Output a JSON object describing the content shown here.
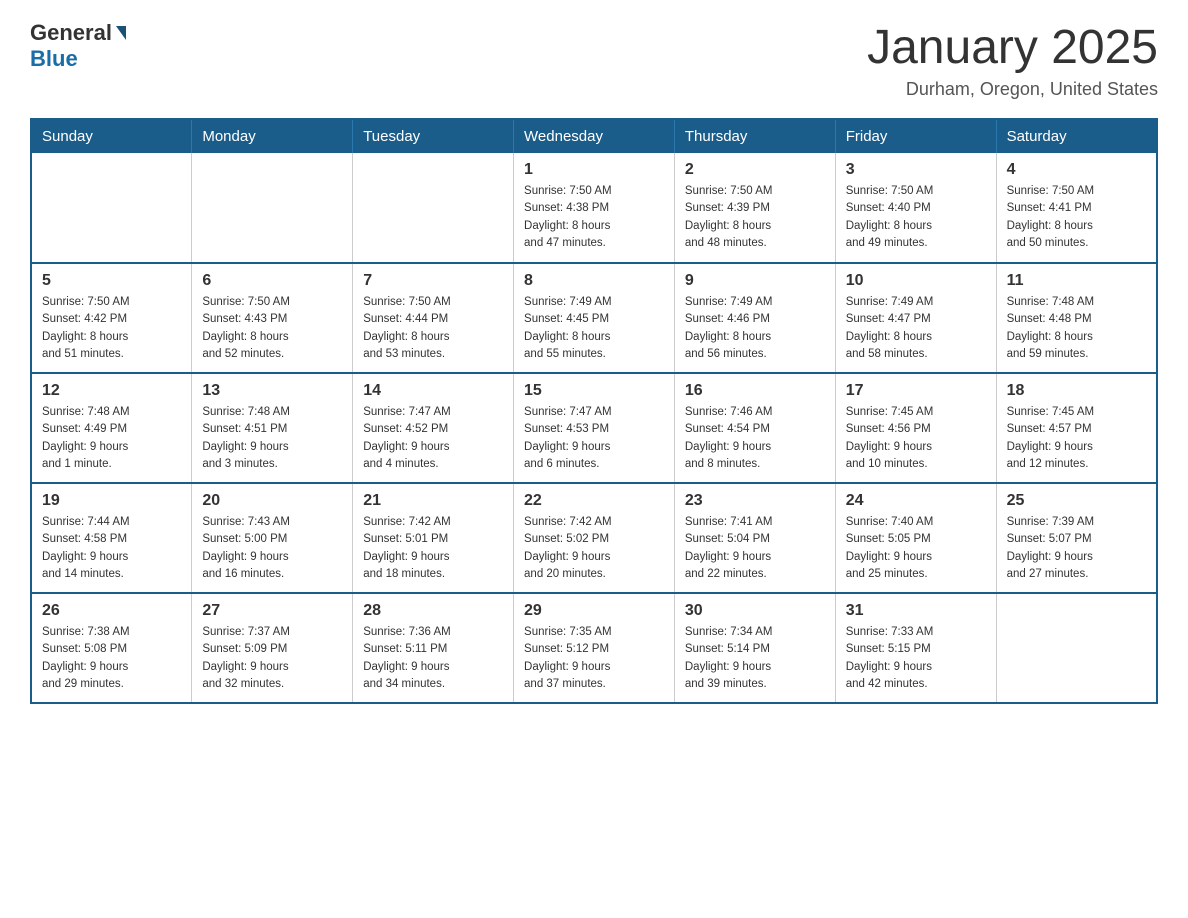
{
  "header": {
    "logo_text_general": "General",
    "logo_text_blue": "Blue",
    "month_title": "January 2025",
    "location": "Durham, Oregon, United States"
  },
  "calendar": {
    "days_of_week": [
      "Sunday",
      "Monday",
      "Tuesday",
      "Wednesday",
      "Thursday",
      "Friday",
      "Saturday"
    ],
    "weeks": [
      [
        {
          "day": "",
          "info": ""
        },
        {
          "day": "",
          "info": ""
        },
        {
          "day": "",
          "info": ""
        },
        {
          "day": "1",
          "info": "Sunrise: 7:50 AM\nSunset: 4:38 PM\nDaylight: 8 hours\nand 47 minutes."
        },
        {
          "day": "2",
          "info": "Sunrise: 7:50 AM\nSunset: 4:39 PM\nDaylight: 8 hours\nand 48 minutes."
        },
        {
          "day": "3",
          "info": "Sunrise: 7:50 AM\nSunset: 4:40 PM\nDaylight: 8 hours\nand 49 minutes."
        },
        {
          "day": "4",
          "info": "Sunrise: 7:50 AM\nSunset: 4:41 PM\nDaylight: 8 hours\nand 50 minutes."
        }
      ],
      [
        {
          "day": "5",
          "info": "Sunrise: 7:50 AM\nSunset: 4:42 PM\nDaylight: 8 hours\nand 51 minutes."
        },
        {
          "day": "6",
          "info": "Sunrise: 7:50 AM\nSunset: 4:43 PM\nDaylight: 8 hours\nand 52 minutes."
        },
        {
          "day": "7",
          "info": "Sunrise: 7:50 AM\nSunset: 4:44 PM\nDaylight: 8 hours\nand 53 minutes."
        },
        {
          "day": "8",
          "info": "Sunrise: 7:49 AM\nSunset: 4:45 PM\nDaylight: 8 hours\nand 55 minutes."
        },
        {
          "day": "9",
          "info": "Sunrise: 7:49 AM\nSunset: 4:46 PM\nDaylight: 8 hours\nand 56 minutes."
        },
        {
          "day": "10",
          "info": "Sunrise: 7:49 AM\nSunset: 4:47 PM\nDaylight: 8 hours\nand 58 minutes."
        },
        {
          "day": "11",
          "info": "Sunrise: 7:48 AM\nSunset: 4:48 PM\nDaylight: 8 hours\nand 59 minutes."
        }
      ],
      [
        {
          "day": "12",
          "info": "Sunrise: 7:48 AM\nSunset: 4:49 PM\nDaylight: 9 hours\nand 1 minute."
        },
        {
          "day": "13",
          "info": "Sunrise: 7:48 AM\nSunset: 4:51 PM\nDaylight: 9 hours\nand 3 minutes."
        },
        {
          "day": "14",
          "info": "Sunrise: 7:47 AM\nSunset: 4:52 PM\nDaylight: 9 hours\nand 4 minutes."
        },
        {
          "day": "15",
          "info": "Sunrise: 7:47 AM\nSunset: 4:53 PM\nDaylight: 9 hours\nand 6 minutes."
        },
        {
          "day": "16",
          "info": "Sunrise: 7:46 AM\nSunset: 4:54 PM\nDaylight: 9 hours\nand 8 minutes."
        },
        {
          "day": "17",
          "info": "Sunrise: 7:45 AM\nSunset: 4:56 PM\nDaylight: 9 hours\nand 10 minutes."
        },
        {
          "day": "18",
          "info": "Sunrise: 7:45 AM\nSunset: 4:57 PM\nDaylight: 9 hours\nand 12 minutes."
        }
      ],
      [
        {
          "day": "19",
          "info": "Sunrise: 7:44 AM\nSunset: 4:58 PM\nDaylight: 9 hours\nand 14 minutes."
        },
        {
          "day": "20",
          "info": "Sunrise: 7:43 AM\nSunset: 5:00 PM\nDaylight: 9 hours\nand 16 minutes."
        },
        {
          "day": "21",
          "info": "Sunrise: 7:42 AM\nSunset: 5:01 PM\nDaylight: 9 hours\nand 18 minutes."
        },
        {
          "day": "22",
          "info": "Sunrise: 7:42 AM\nSunset: 5:02 PM\nDaylight: 9 hours\nand 20 minutes."
        },
        {
          "day": "23",
          "info": "Sunrise: 7:41 AM\nSunset: 5:04 PM\nDaylight: 9 hours\nand 22 minutes."
        },
        {
          "day": "24",
          "info": "Sunrise: 7:40 AM\nSunset: 5:05 PM\nDaylight: 9 hours\nand 25 minutes."
        },
        {
          "day": "25",
          "info": "Sunrise: 7:39 AM\nSunset: 5:07 PM\nDaylight: 9 hours\nand 27 minutes."
        }
      ],
      [
        {
          "day": "26",
          "info": "Sunrise: 7:38 AM\nSunset: 5:08 PM\nDaylight: 9 hours\nand 29 minutes."
        },
        {
          "day": "27",
          "info": "Sunrise: 7:37 AM\nSunset: 5:09 PM\nDaylight: 9 hours\nand 32 minutes."
        },
        {
          "day": "28",
          "info": "Sunrise: 7:36 AM\nSunset: 5:11 PM\nDaylight: 9 hours\nand 34 minutes."
        },
        {
          "day": "29",
          "info": "Sunrise: 7:35 AM\nSunset: 5:12 PM\nDaylight: 9 hours\nand 37 minutes."
        },
        {
          "day": "30",
          "info": "Sunrise: 7:34 AM\nSunset: 5:14 PM\nDaylight: 9 hours\nand 39 minutes."
        },
        {
          "day": "31",
          "info": "Sunrise: 7:33 AM\nSunset: 5:15 PM\nDaylight: 9 hours\nand 42 minutes."
        },
        {
          "day": "",
          "info": ""
        }
      ]
    ]
  }
}
